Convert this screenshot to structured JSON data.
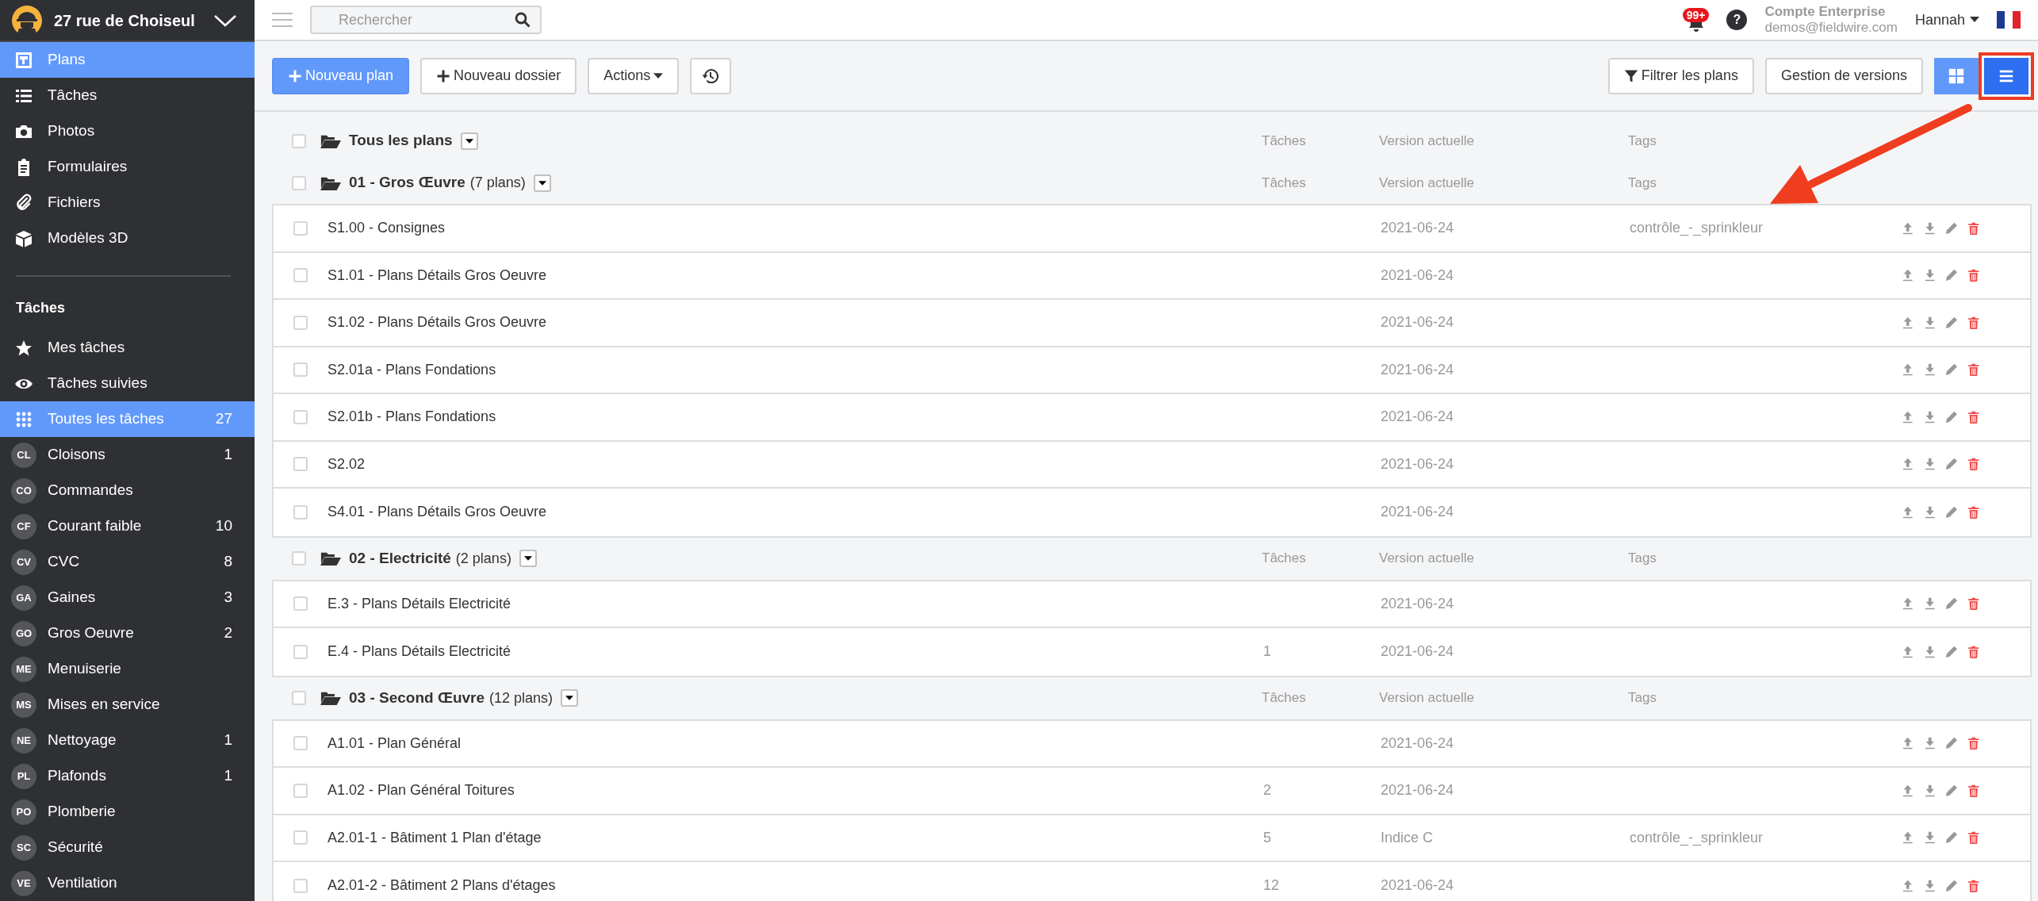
{
  "project": {
    "name": "27 rue de Choiseul"
  },
  "nav": [
    {
      "label": "Plans",
      "kind": "plans",
      "selected": true
    },
    {
      "label": "Tâches",
      "kind": "list",
      "selected": false
    },
    {
      "label": "Photos",
      "kind": "camera",
      "selected": false
    },
    {
      "label": "Formulaires",
      "kind": "clipboard",
      "selected": false
    },
    {
      "label": "Fichiers",
      "kind": "paperclip",
      "selected": false
    },
    {
      "label": "Modèles 3D",
      "kind": "cube",
      "selected": false
    }
  ],
  "tasks_heading": "Tâches",
  "task_filters": [
    {
      "label": "Mes tâches",
      "kind": "star",
      "selected": false
    },
    {
      "label": "Tâches suivies",
      "kind": "eye",
      "selected": false
    },
    {
      "label": "Toutes les tâches",
      "kind": "dots",
      "count": "27",
      "selected": true
    }
  ],
  "teams": [
    {
      "abbr": "CL",
      "label": "Cloisons",
      "count": "1"
    },
    {
      "abbr": "CO",
      "label": "Commandes"
    },
    {
      "abbr": "CF",
      "label": "Courant faible",
      "count": "10"
    },
    {
      "abbr": "CV",
      "label": "CVC",
      "count": "8"
    },
    {
      "abbr": "GA",
      "label": "Gaines",
      "count": "3"
    },
    {
      "abbr": "GO",
      "label": "Gros Oeuvre",
      "count": "2"
    },
    {
      "abbr": "ME",
      "label": "Menuiserie"
    },
    {
      "abbr": "MS",
      "label": "Mises en service"
    },
    {
      "abbr": "NE",
      "label": "Nettoyage",
      "count": "1"
    },
    {
      "abbr": "PL",
      "label": "Plafonds",
      "count": "1"
    },
    {
      "abbr": "PO",
      "label": "Plomberie"
    },
    {
      "abbr": "SC",
      "label": "Sécurité"
    },
    {
      "abbr": "VE",
      "label": "Ventilation"
    }
  ],
  "topbar": {
    "search_placeholder": "Rechercher",
    "notifications": "99+",
    "help": "?",
    "account_type": "Compte Enterprise",
    "email": "demos@fieldwire.com",
    "user": "Hannah"
  },
  "toolbar_left": [
    {
      "kind": "primary-add",
      "label": "Nouveau plan"
    },
    {
      "kind": "add",
      "label": "Nouveau dossier"
    },
    {
      "kind": "dropdown",
      "label": "Actions"
    },
    {
      "kind": "history"
    }
  ],
  "toolbar_right": [
    {
      "kind": "filter",
      "label": "Filtrer les plans"
    },
    {
      "kind": "plain",
      "label": "Gestion de versions"
    }
  ],
  "view_toggle": [
    {
      "kind": "tiles",
      "selected": false,
      "highlighted": false
    },
    {
      "kind": "list",
      "selected": true,
      "highlighted": true
    }
  ],
  "folders": [
    {
      "name": "Tous les plans",
      "checked": false,
      "columns": [
        "Tâches",
        "Version actuelle",
        "Tags"
      ]
    },
    {
      "name": "01 - Gros Œuvre",
      "count": "(7 plans)",
      "checked": false,
      "columns": [
        "Tâches",
        "Version actuelle",
        "Tags"
      ],
      "plans": [
        {
          "name": "S1.00 - Consignes",
          "checked": false,
          "version": "2021-06-24",
          "tag": "contrôle_-_sprinkleur"
        },
        {
          "name": "S1.01 - Plans Détails Gros Oeuvre",
          "checked": false,
          "version": "2021-06-24"
        },
        {
          "name": "S1.02 - Plans Détails Gros Oeuvre",
          "checked": false,
          "version": "2021-06-24"
        },
        {
          "name": "S2.01a - Plans Fondations",
          "checked": false,
          "version": "2021-06-24"
        },
        {
          "name": "S2.01b - Plans Fondations",
          "checked": false,
          "version": "2021-06-24"
        },
        {
          "name": "S2.02",
          "checked": false,
          "version": "2021-06-24"
        },
        {
          "name": "S4.01 - Plans Détails Gros Oeuvre",
          "checked": false,
          "version": "2021-06-24"
        }
      ]
    },
    {
      "name": "02 - Electricité",
      "count": "(2 plans)",
      "checked": false,
      "columns": [
        "Tâches",
        "Version actuelle",
        "Tags"
      ],
      "plans": [
        {
          "name": "E.3 - Plans Détails Electricité",
          "checked": false,
          "version": "2021-06-24"
        },
        {
          "name": "E.4 - Plans Détails Electricité",
          "checked": false,
          "tasks": "1",
          "version": "2021-06-24"
        }
      ]
    },
    {
      "name": "03 - Second Œuvre",
      "count": "(12 plans)",
      "checked": false,
      "columns": [
        "Tâches",
        "Version actuelle",
        "Tags"
      ],
      "plans": [
        {
          "name": "A1.01 - Plan Général",
          "checked": false,
          "version": "2021-06-24"
        },
        {
          "name": "A1.02 - Plan Général Toitures",
          "checked": false,
          "tasks": "2",
          "version": "2021-06-24"
        },
        {
          "name": "A2.01-1 - Bâtiment 1 Plan d'étage",
          "checked": false,
          "tasks": "5",
          "version": "Indice C",
          "tag": "contrôle_-_sprinkleur"
        },
        {
          "name": "A2.01-2 - Bâtiment 2 Plans d'étages",
          "checked": false,
          "tasks": "12",
          "version": "2021-06-24"
        }
      ]
    }
  ]
}
